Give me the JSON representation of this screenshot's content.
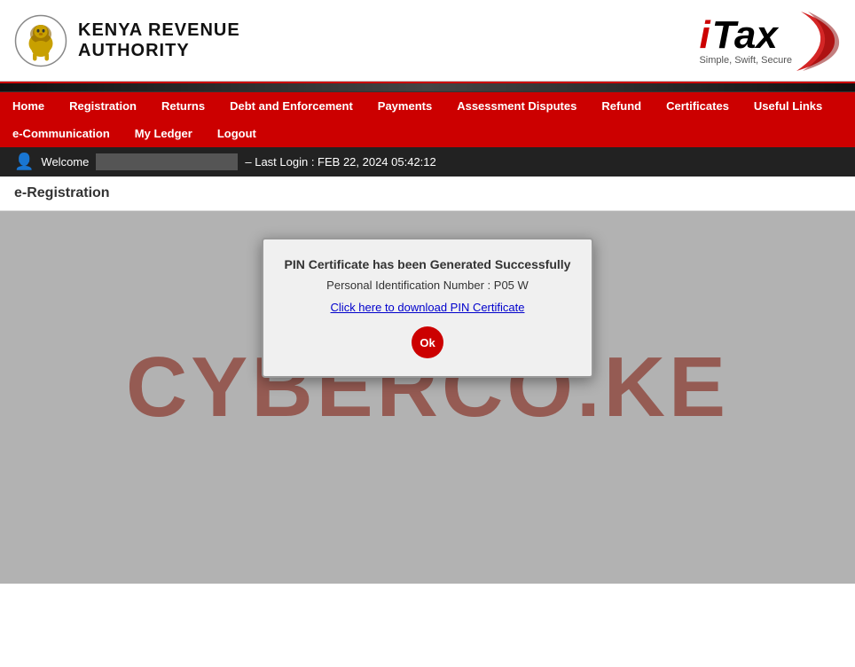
{
  "header": {
    "kra_title_line1": "Kenya Revenue",
    "kra_title_line2": "Authority",
    "itax_brand": "iTax",
    "itax_tagline": "Simple, Swift, Secure"
  },
  "nav": {
    "items_row1": [
      {
        "id": "home",
        "label": "Home"
      },
      {
        "id": "registration",
        "label": "Registration"
      },
      {
        "id": "returns",
        "label": "Returns"
      },
      {
        "id": "debt-enforcement",
        "label": "Debt and Enforcement"
      },
      {
        "id": "payments",
        "label": "Payments"
      },
      {
        "id": "assessment-disputes",
        "label": "Assessment Disputes"
      },
      {
        "id": "refund",
        "label": "Refund"
      },
      {
        "id": "certificates",
        "label": "Certificates"
      },
      {
        "id": "useful-links",
        "label": "Useful Links"
      }
    ],
    "items_row2": [
      {
        "id": "e-communication",
        "label": "e-Communication"
      },
      {
        "id": "my-ledger",
        "label": "My Ledger"
      },
      {
        "id": "logout",
        "label": "Logout"
      }
    ]
  },
  "welcome_bar": {
    "welcome_label": "Welcome",
    "user_value": "",
    "last_login_text": "– Last Login : FEB 22, 2024 05:42:12"
  },
  "page": {
    "title": "e-Registration"
  },
  "watermark": {
    "text": "CYBERCO.KE"
  },
  "modal": {
    "title": "PIN Certificate has been Generated Successfully",
    "pin_label": "Personal Identification Number : P05",
    "pin_suffix": "W",
    "download_link": "Click here to download PIN Certificate",
    "ok_button_label": "Ok"
  }
}
